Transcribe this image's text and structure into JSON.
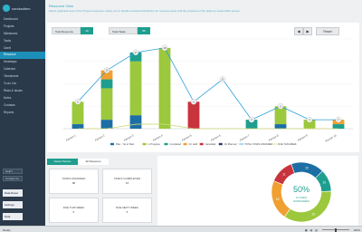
{
  "sidebar": {
    "logo_text": "conductimo",
    "items": [
      {
        "label": "Dashboard",
        "active": false
      },
      {
        "label": "Projects",
        "active": false
      },
      {
        "label": "Milestones",
        "active": false
      },
      {
        "label": "Tasks",
        "active": false
      },
      {
        "label": "Gantt",
        "active": false
      },
      {
        "label": "Resource",
        "active": true
      },
      {
        "label": "Heatmaps",
        "active": false
      },
      {
        "label": "Calendar",
        "active": false
      },
      {
        "label": "Timesheets",
        "active": false
      },
      {
        "label": "To-do List",
        "active": false
      },
      {
        "label": "Risks & Issues",
        "active": false
      },
      {
        "label": "Notes",
        "active": false
      },
      {
        "label": "Contacts",
        "active": false
      },
      {
        "label": "Reports",
        "active": false
      }
    ],
    "input1": "Help?",
    "input2": "Contact Us",
    "btn_data_reset": "Data Reset",
    "btn_settings": "Settings",
    "btn_data": "Data"
  },
  "header": {
    "title": "Resource View",
    "subtitle": "Select graphical view of the Project resources. Helps you to decide workload distribution for resource team and the progress of the tasks by responsible person."
  },
  "filters": {
    "resource_label": "Total Resource",
    "resource_value": "10",
    "tasks_label": "Total Tasks",
    "tasks_value": "86"
  },
  "pager": {
    "prev": "◀",
    "next": "▶",
    "reset": "Reset"
  },
  "chart_data": {
    "type": "bar",
    "stacked": true,
    "categories": [
      "Person 1",
      "Person 2",
      "Person 3",
      "Person 4",
      "Person 5",
      "Person 6",
      "Person 7",
      "Person 8",
      "Person 9",
      "Person 10"
    ],
    "series": [
      {
        "name": "Plan - Yet to Start",
        "color": "#1c6ea4",
        "values": [
          1,
          2,
          3,
          0,
          0,
          0,
          0,
          1,
          0,
          0
        ]
      },
      {
        "name": "In Progress",
        "color": "#9bc83c",
        "values": [
          5,
          7,
          12,
          18,
          0,
          0,
          0,
          4,
          2,
          0
        ]
      },
      {
        "name": "Completed",
        "color": "#1e9e8e",
        "values": [
          0,
          2,
          2,
          0,
          0,
          0,
          2,
          0,
          0,
          1
        ]
      },
      {
        "name": "On Hold",
        "color": "#f0a030",
        "values": [
          0,
          2,
          0,
          0,
          0,
          0,
          0,
          0,
          0,
          1
        ]
      },
      {
        "name": "Cancelled",
        "color": "#c8333c",
        "values": [
          0,
          0,
          0,
          0,
          6,
          0,
          0,
          0,
          0,
          0
        ]
      },
      {
        "name": "On Planned",
        "color": "#2b3a6a",
        "values": [
          0,
          0,
          0,
          0,
          0,
          0,
          0,
          0,
          0,
          0
        ]
      }
    ],
    "line_series": [
      {
        "name": "TOTAL TASKS ASSIGNED",
        "color": "#2a9fd8",
        "values": [
          6,
          13,
          17,
          18,
          6,
          11,
          2,
          5,
          2,
          2
        ]
      },
      {
        "name": "DUE THIS WEEK",
        "color": "#cdd87a",
        "values": [
          0,
          0,
          1,
          1,
          0,
          0,
          0,
          0,
          0,
          0
        ]
      }
    ],
    "ylim": [
      0,
      20
    ]
  },
  "tabs": [
    "Select Person",
    "All Resource"
  ],
  "cards": [
    {
      "label": "TASKS ASSIGNED",
      "value": "86"
    },
    {
      "label": "TASKS COMPLETED",
      "value": "15"
    },
    {
      "label": "DUE THIS WEEK",
      "value": "5"
    },
    {
      "label": "DUE NEXT WEEK",
      "value": "5"
    }
  ],
  "donut": {
    "percent": "50%",
    "sub1": "12 TASKS",
    "sub2": "IN PROGRESS",
    "segments": [
      {
        "label": "15",
        "value": 15,
        "color": "#1c6ea4"
      },
      {
        "label": "10",
        "value": 10,
        "color": "#1e9e8e"
      },
      {
        "label": "29",
        "value": 29,
        "color": "#9bc83c"
      },
      {
        "label": "18",
        "value": 18,
        "color": "#f0a030"
      },
      {
        "label": "11",
        "value": 11,
        "color": "#c8333c"
      }
    ]
  },
  "status": {
    "ready": "Ready",
    "zoom": "100%"
  }
}
